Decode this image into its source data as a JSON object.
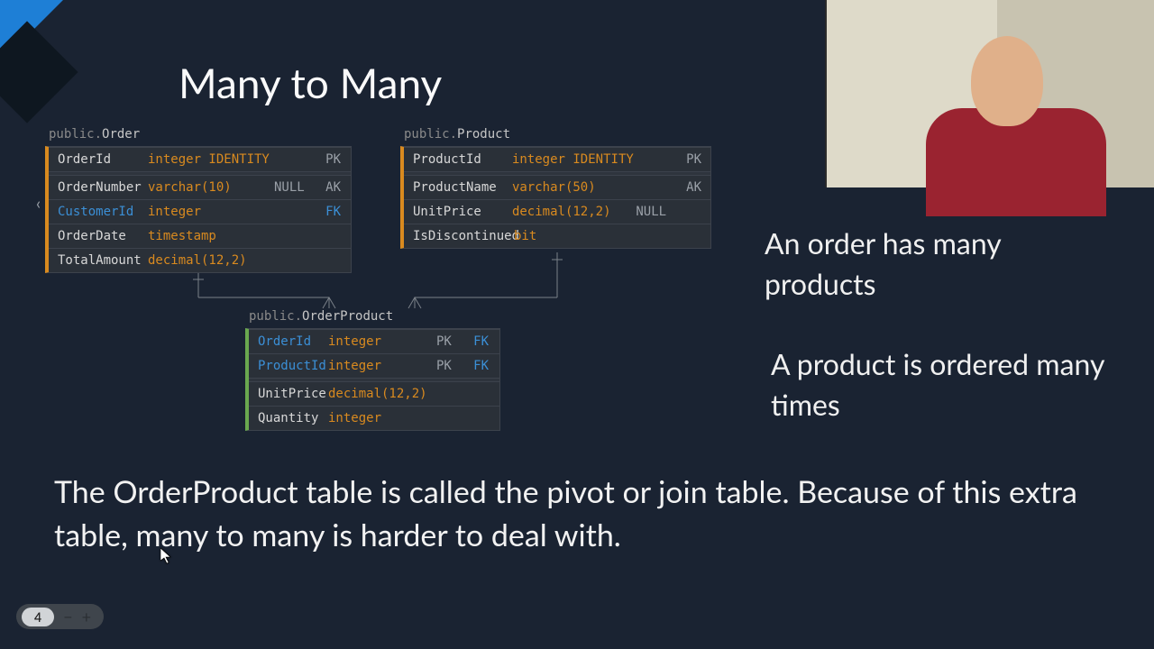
{
  "slide": {
    "title": "Many to Many",
    "page": "4",
    "notes": {
      "a": "An order has many products",
      "b": "A product is ordered many times"
    },
    "paragraph": "The OrderProduct table is called the pivot or join table. Because of this extra table, many to many is harder to deal with."
  },
  "schema_label": "public.",
  "tables": {
    "order": {
      "name": "Order",
      "pk": [
        {
          "col": "OrderId",
          "type": "integer IDENTITY",
          "f1": "",
          "f2": "PK"
        }
      ],
      "rows": [
        {
          "col": "OrderNumber",
          "type": "varchar(10)",
          "f1": "NULL",
          "f2": "AK",
          "fk": false
        },
        {
          "col": "CustomerId",
          "type": "integer",
          "f1": "",
          "f2": "FK",
          "fk": true
        },
        {
          "col": "OrderDate",
          "type": "timestamp",
          "f1": "",
          "f2": "",
          "fk": false
        },
        {
          "col": "TotalAmount",
          "type": "decimal(12,2)",
          "f1": "",
          "f2": "",
          "fk": false
        }
      ]
    },
    "product": {
      "name": "Product",
      "pk": [
        {
          "col": "ProductId",
          "type": "integer IDENTITY",
          "f1": "",
          "f2": "PK"
        }
      ],
      "rows": [
        {
          "col": "ProductName",
          "type": "varchar(50)",
          "f1": "",
          "f2": "AK",
          "fk": false
        },
        {
          "col": "UnitPrice",
          "type": "decimal(12,2)",
          "f1": "NULL",
          "f2": "",
          "fk": false
        },
        {
          "col": "IsDiscontinued",
          "type": "bit",
          "f1": "",
          "f2": "",
          "fk": false
        }
      ]
    },
    "orderproduct": {
      "name": "OrderProduct",
      "pk": [
        {
          "col": "OrderId",
          "type": "integer",
          "f1": "PK",
          "f2": "FK",
          "fk": true
        },
        {
          "col": "ProductId",
          "type": "integer",
          "f1": "PK",
          "f2": "FK",
          "fk": true
        }
      ],
      "rows": [
        {
          "col": "UnitPrice",
          "type": "decimal(12,2)",
          "f1": "",
          "f2": "",
          "fk": false
        },
        {
          "col": "Quantity",
          "type": "integer",
          "f1": "",
          "f2": "",
          "fk": false
        }
      ]
    }
  }
}
